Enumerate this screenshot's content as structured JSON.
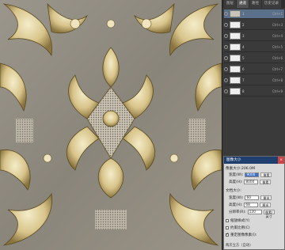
{
  "panel": {
    "tabs": [
      "图层",
      "通道",
      "路径",
      "历史记录"
    ],
    "active_tab": 1,
    "layers": [
      {
        "name": "1",
        "shortcut": "Ctrl+1"
      },
      {
        "name": "2",
        "shortcut": "Ctrl+3"
      },
      {
        "name": "3",
        "shortcut": "Ctrl+4"
      },
      {
        "name": "4",
        "shortcut": "Ctrl+5"
      },
      {
        "name": "5",
        "shortcut": "Ctrl+6"
      },
      {
        "name": "6",
        "shortcut": "Ctrl+7"
      },
      {
        "name": "7",
        "shortcut": "Ctrl+8"
      },
      {
        "name": "8",
        "shortcut": "Ctrl+9"
      }
    ]
  },
  "dialog": {
    "title": "图像大小",
    "pixel_dim": "像素大小:206.0M",
    "width_label": "宽度(W):",
    "width_value": "9000",
    "height_label": "高度(H):",
    "height_value": "8000",
    "unit_pixels": "像素",
    "doc_size": "文档大小:",
    "doc_width_value": "60",
    "doc_height_value": "68",
    "resolution_label": "分辨率(R):",
    "resolution_value": "120",
    "unit_cm": "厘米",
    "unit_ppi": "像素/英寸",
    "scale_styles": "缩放样式(Y)",
    "constrain": "约束比例(C)",
    "resample": "重定图像像素(I):",
    "bottom_text": "两次立方（自动）"
  }
}
